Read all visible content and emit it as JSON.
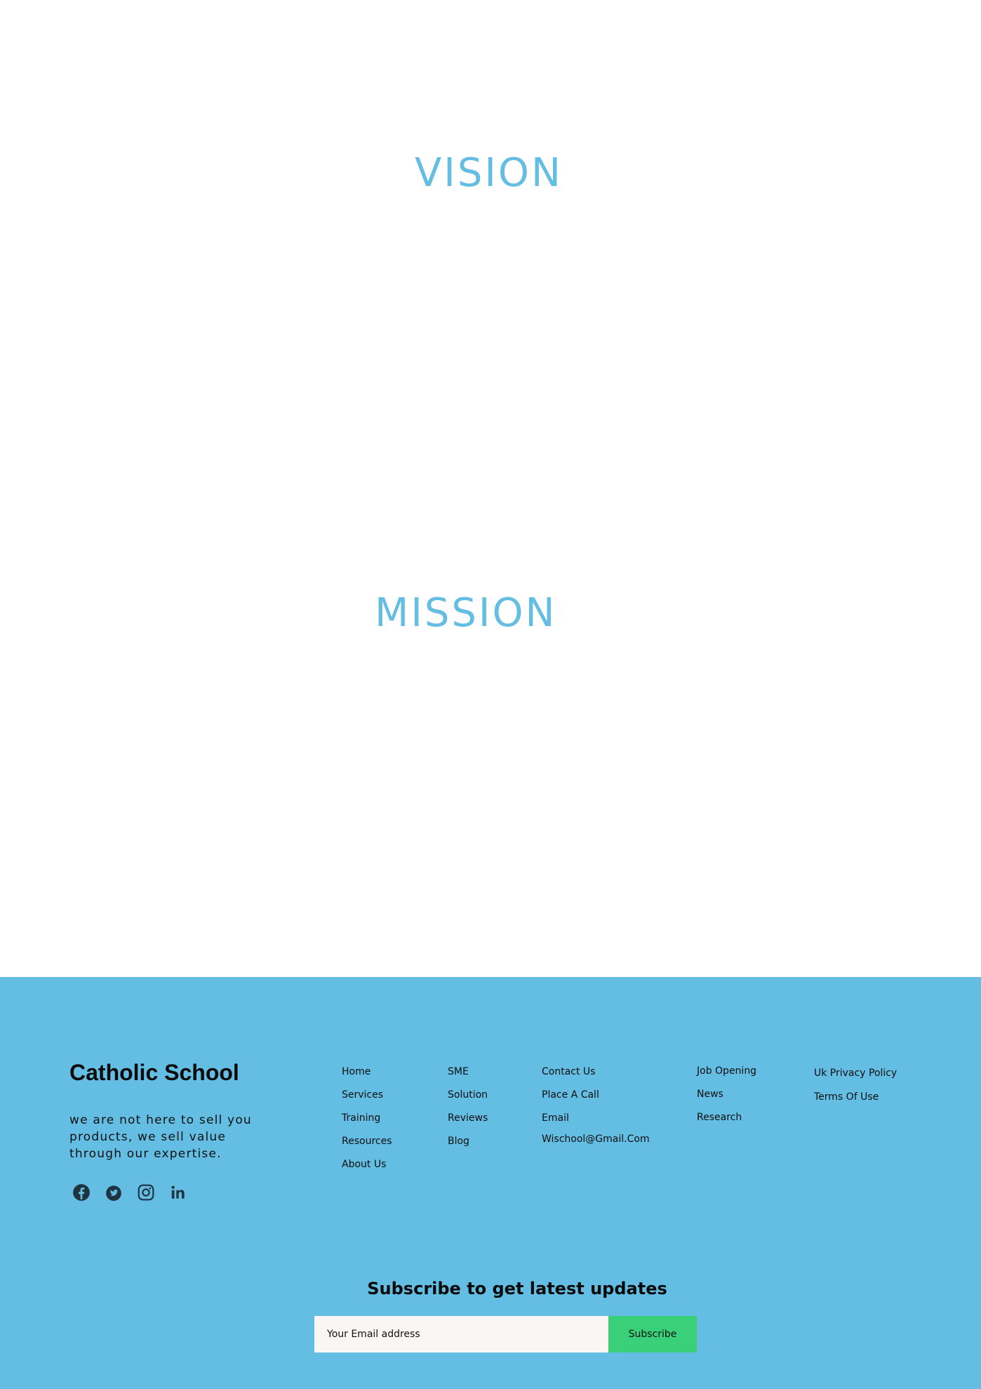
{
  "sections": {
    "vision_title": "VISION",
    "mission_title": "MISSION"
  },
  "colors": {
    "accent": "#64bde2",
    "subscribe_button": "#3ad07a",
    "input_background": "#faf6f5",
    "social_icons": "#1f3440"
  },
  "footer": {
    "brand": "Catholic School",
    "tagline": "we are not here to sell you products, we sell value through our expertise.",
    "socials": [
      "facebook-icon",
      "twitter-icon",
      "instagram-icon",
      "linkedin-icon"
    ],
    "columns": [
      [
        "Home",
        "Services",
        "Training",
        "Resources",
        "About Us"
      ],
      [
        "SME",
        "Solution",
        "Reviews",
        "Blog"
      ],
      [
        "Contact Us",
        "Place A Call",
        "Email",
        "Wischool@Gmail.Com"
      ],
      [
        "Job Opening",
        "News",
        "Research"
      ],
      [
        "Uk Privacy Policy",
        "Terms Of Use"
      ]
    ],
    "subscribe": {
      "title": "Subscribe to get latest updates",
      "placeholder": "Your Email address",
      "button": "Subscribe"
    }
  }
}
